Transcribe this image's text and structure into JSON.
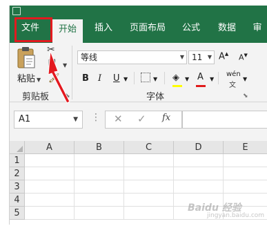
{
  "ribbon_tabs": {
    "file": "文件",
    "home": "开始",
    "insert": "插入",
    "page_layout": "页面布局",
    "formulas": "公式",
    "data": "数据",
    "review": "审"
  },
  "clipboard": {
    "paste_label": "粘贴",
    "group_label": "剪贴板"
  },
  "font": {
    "font_name": "等线",
    "font_size": "11",
    "grow_label": "A",
    "shrink_label": "A",
    "bold_label": "B",
    "italic_label": "I",
    "underline_label": "U",
    "font_color_label": "A",
    "phonetic_label": "wén",
    "phonetic_sub": "文",
    "group_label": "字体"
  },
  "formula_bar": {
    "name_box": "A1",
    "fx_label": "fx",
    "formula_value": ""
  },
  "grid": {
    "columns": [
      "A",
      "B",
      "C",
      "D",
      "E"
    ],
    "rows": [
      "1",
      "2",
      "3",
      "4",
      "5"
    ]
  },
  "colors": {
    "ribbon_green": "#217346",
    "highlight_red": "#e3191f",
    "fill_yellow": "#ffff00",
    "font_red": "#e01b1b"
  },
  "icons": {
    "paste": "clipboard-icon",
    "cut": "scissors-icon",
    "copy": "copy-icon",
    "format_painter": "brush-icon",
    "border": "border-icon",
    "fill": "paint-bucket-icon",
    "cancel": "close-icon",
    "enter": "check-icon"
  },
  "watermark": {
    "text": "Baidu 经验",
    "sub": "jingyan.baidu.com"
  }
}
